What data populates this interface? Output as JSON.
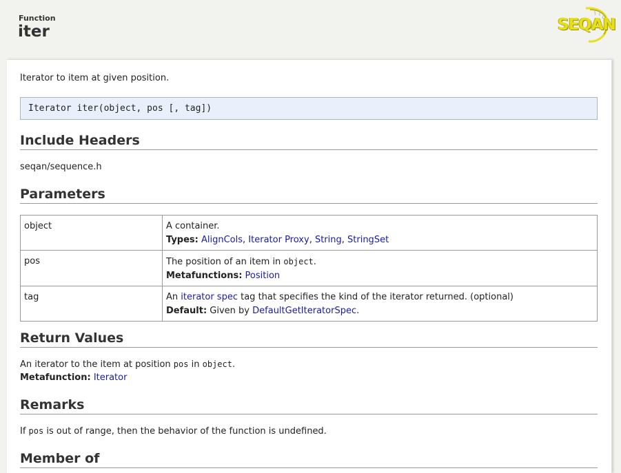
{
  "header": {
    "kind": "Function",
    "name": "iter",
    "logo_text": "SEQAN"
  },
  "summary": "Iterator to item at given position.",
  "signature": "Iterator iter(object, pos [, tag])",
  "sections": {
    "include_headers": "Include Headers",
    "parameters": "Parameters",
    "return_values": "Return Values",
    "remarks": "Remarks",
    "member_of": "Member of"
  },
  "include_header": "seqan/sequence.h",
  "parameters": [
    {
      "name": "object",
      "description": "A container.",
      "meta_label": "Types:",
      "links": [
        "AlignCols",
        "Iterator Proxy",
        "String",
        "StringSet"
      ]
    },
    {
      "name": "pos",
      "description_pre": "The position of an item in ",
      "description_code": "object",
      "description_post": ".",
      "meta_label": "Metafunctions:",
      "links": [
        "Position"
      ]
    },
    {
      "name": "tag",
      "description_pre": "An ",
      "description_link": "iterator spec",
      "description_post": " tag that specifies the kind of the iterator returned. (optional)",
      "meta_label": "Default:",
      "meta_pre": " Given by ",
      "links": [
        "DefaultGetIteratorSpec"
      ],
      "meta_post": "."
    }
  ],
  "return_value": {
    "pre": "An iterator to the item at position ",
    "code1": "pos",
    "mid": " in ",
    "code2": "object",
    "post": ".",
    "meta_label": "Metafunction:",
    "link": "Iterator"
  },
  "remarks": {
    "pre": "If ",
    "code": "pos",
    "post": " is out of range, then the behavior of the function is undefined."
  },
  "colors": {
    "background": "#f2f2ee",
    "link": "#1a1aa6",
    "signature_bg": "#eaf0fb",
    "logo": "#e6df1c"
  }
}
